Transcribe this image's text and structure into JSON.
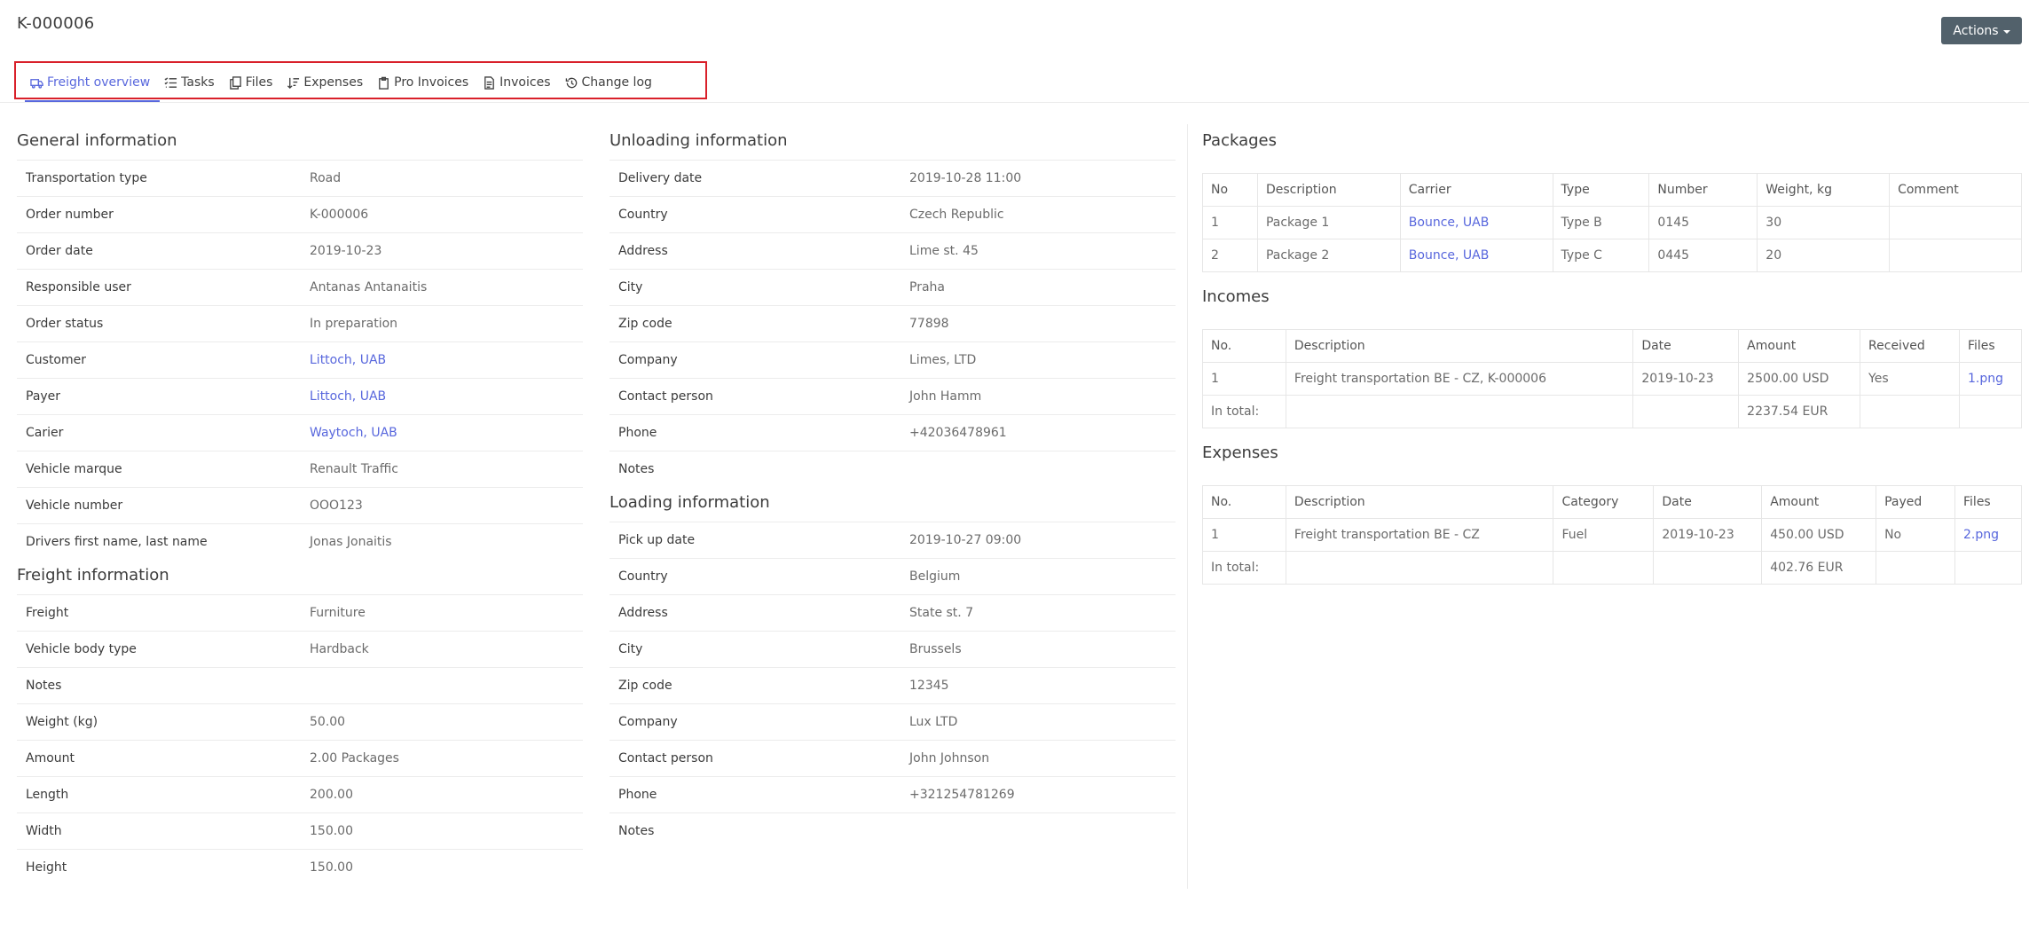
{
  "page": {
    "title": "K-000006"
  },
  "actions": {
    "label": "Actions"
  },
  "tabs": [
    {
      "label": "Freight overview",
      "icon": "truck-icon"
    },
    {
      "label": "Tasks",
      "icon": "tasks-icon"
    },
    {
      "label": "Files",
      "icon": "files-icon"
    },
    {
      "label": "Expenses",
      "icon": "sort-icon"
    },
    {
      "label": "Pro Invoices",
      "icon": "clipboard-icon"
    },
    {
      "label": "Invoices",
      "icon": "document-icon"
    },
    {
      "label": "Change log",
      "icon": "history-icon"
    }
  ],
  "general": {
    "title": "General information",
    "rows": [
      {
        "k": "Transportation type",
        "v": "Road"
      },
      {
        "k": "Order number",
        "v": "K-000006"
      },
      {
        "k": "Order date",
        "v": "2019-10-23"
      },
      {
        "k": "Responsible user",
        "v": "Antanas Antanaitis"
      },
      {
        "k": "Order status",
        "v": "In preparation"
      },
      {
        "k": "Customer",
        "v": "Littoch, UAB"
      },
      {
        "k": "Payer",
        "v": "Littoch, UAB"
      },
      {
        "k": "Carier",
        "v": "Waytoch, UAB"
      },
      {
        "k": "Vehicle marque",
        "v": "Renault Traffic"
      },
      {
        "k": "Vehicle number",
        "v": "OOO123"
      },
      {
        "k": "Drivers first name, last name",
        "v": "Jonas Jonaitis"
      }
    ]
  },
  "freight": {
    "title": "Freight information",
    "rows": [
      {
        "k": "Freight",
        "v": "Furniture"
      },
      {
        "k": "Vehicle body type",
        "v": "Hardback"
      },
      {
        "k": "Notes",
        "v": ""
      },
      {
        "k": "Weight (kg)",
        "v": "50.00"
      },
      {
        "k": "Amount",
        "v": "2.00 Packages"
      },
      {
        "k": "Length",
        "v": "200.00"
      },
      {
        "k": "Width",
        "v": "150.00"
      },
      {
        "k": "Height",
        "v": "150.00"
      }
    ]
  },
  "unloading": {
    "title": "Unloading information",
    "rows": [
      {
        "k": "Delivery date",
        "v": "2019-10-28 11:00"
      },
      {
        "k": "Country",
        "v": "Czech Republic"
      },
      {
        "k": "Address",
        "v": "Lime st. 45"
      },
      {
        "k": "City",
        "v": "Praha"
      },
      {
        "k": "Zip code",
        "v": "77898"
      },
      {
        "k": "Company",
        "v": "Limes, LTD"
      },
      {
        "k": "Contact person",
        "v": "John Hamm"
      },
      {
        "k": "Phone",
        "v": "+42036478961"
      },
      {
        "k": "Notes",
        "v": ""
      }
    ]
  },
  "loading": {
    "title": "Loading information",
    "rows": [
      {
        "k": "Pick up date",
        "v": "2019-10-27 09:00"
      },
      {
        "k": "Country",
        "v": "Belgium"
      },
      {
        "k": "Address",
        "v": "State st. 7"
      },
      {
        "k": "City",
        "v": "Brussels"
      },
      {
        "k": "Zip code",
        "v": "12345"
      },
      {
        "k": "Company",
        "v": "Lux LTD"
      },
      {
        "k": "Contact person",
        "v": "John Johnson"
      },
      {
        "k": "Phone",
        "v": "+321254781269"
      },
      {
        "k": "Notes",
        "v": ""
      }
    ]
  },
  "packages": {
    "title": "Packages",
    "headers": [
      "No",
      "Description",
      "Carrier",
      "Type",
      "Number",
      "Weight, kg",
      "Comment"
    ],
    "rows": [
      [
        "1",
        "Package 1",
        "Bounce, UAB",
        "Type B",
        "0145",
        "30",
        ""
      ],
      [
        "2",
        "Package 2",
        "Bounce, UAB",
        "Type C",
        "0445",
        "20",
        ""
      ]
    ]
  },
  "incomes": {
    "title": "Incomes",
    "headers": [
      "No.",
      "Description",
      "Date",
      "Amount",
      "Received",
      "Files"
    ],
    "rows": [
      [
        "1",
        "Freight transportation BE - CZ, K-000006",
        "2019-10-23",
        "2500.00 USD",
        "Yes",
        "1.png"
      ],
      [
        "In total:",
        "",
        "",
        "2237.54 EUR",
        "",
        ""
      ]
    ]
  },
  "expenses": {
    "title": "Expenses",
    "headers": [
      "No.",
      "Description",
      "Category",
      "Date",
      "Amount",
      "Payed",
      "Files"
    ],
    "rows": [
      [
        "1",
        "Freight transportation BE - CZ",
        "Fuel",
        "2019-10-23",
        "450.00 USD",
        "No",
        "2.png"
      ],
      [
        "In total:",
        "",
        "",
        "",
        "402.76 EUR",
        "",
        ""
      ]
    ]
  },
  "colors": {
    "accent": "#5867dd",
    "actions_bg": "#52616b",
    "highlight": "#d9202a"
  }
}
